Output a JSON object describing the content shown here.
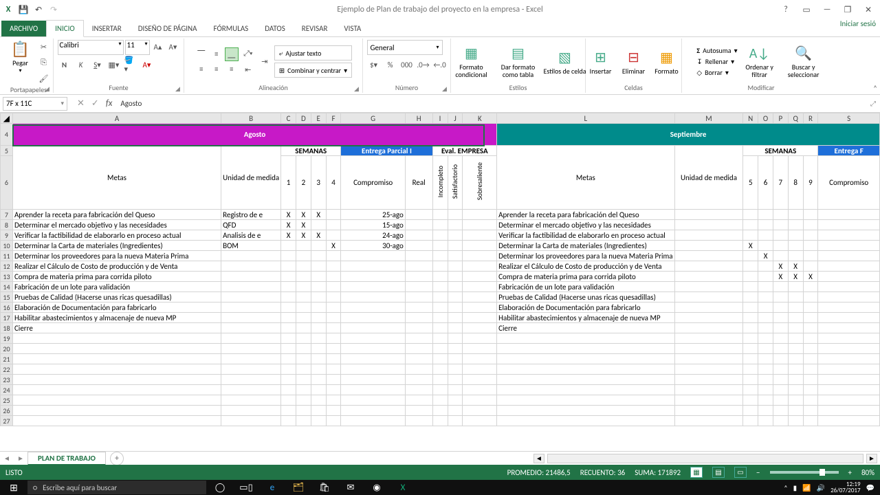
{
  "app": {
    "title": "Ejemplo de Plan de trabajo del proyecto en la empresa - Excel",
    "signin": "Iniciar sesió"
  },
  "tabs": {
    "file": "ARCHIVO",
    "inicio": "INICIO",
    "insertar": "INSERTAR",
    "diseno": "DISEÑO DE PÁGINA",
    "formulas": "FÓRMULAS",
    "datos": "DATOS",
    "revisar": "REVISAR",
    "vista": "VISTA"
  },
  "ribbon": {
    "paste": "Pegar",
    "portapapeles": "Portapapeles",
    "font_name": "Calibri",
    "font_size": "11",
    "fuente": "Fuente",
    "wrap": "Ajustar texto",
    "merge": "Combinar y centrar",
    "alineacion": "Alineación",
    "num_general": "General",
    "numero": "Número",
    "fcond": "Formato condicional",
    "ftabla": "Dar formato como tabla",
    "fcelda": "Estilos de celda",
    "estilos": "Estilos",
    "insertar": "Insertar",
    "eliminar": "Eliminar",
    "formato": "Formato",
    "celdas": "Celdas",
    "autosuma": "Autosuma",
    "rellenar": "Rellenar",
    "borrar": "Borrar",
    "ordenar": "Ordenar y filtrar",
    "buscar": "Buscar y seleccionar",
    "modificar": "Modificar"
  },
  "fxbar": {
    "name": "7F x 11C",
    "formula": "Agosto"
  },
  "cols": [
    "A",
    "B",
    "C",
    "D",
    "E",
    "F",
    "G",
    "H",
    "I",
    "J",
    "K",
    "L",
    "M",
    "N",
    "O",
    "P",
    "Q",
    "R",
    "S"
  ],
  "rows": [
    4,
    5,
    6,
    7,
    8,
    9,
    10,
    11,
    12,
    13,
    14,
    15,
    16,
    17,
    18,
    19,
    20,
    21,
    22,
    23,
    24,
    25,
    26,
    27
  ],
  "months": {
    "aug": "Agosto",
    "sep": "Septiembre"
  },
  "hdr": {
    "metas": "Metas",
    "unidad": "Unidad de medida",
    "semanas": "SEMANAS",
    "entrega": "Entrega Parcial I",
    "entrega2": "Entrega F",
    "evalemp": "Eval. EMPRESA",
    "compromiso": "Compromiso",
    "real": "Real",
    "incompleto": "Incompleto",
    "satisfactorio": "Satisfactorio",
    "sobresaliente": "Sobresaliente",
    "w1": "1",
    "w2": "2",
    "w3": "3",
    "w4": "4",
    "w5": "5",
    "w6": "6",
    "w7": "7",
    "w8": "8",
    "w9": "9"
  },
  "data": [
    {
      "meta": "Aprender la receta para fabricación del Queso",
      "unidad": "Registro de e",
      "w": [
        "X",
        "X",
        "X",
        ""
      ],
      "comp": "25-ago",
      "real": "",
      "s": [
        "",
        "",
        "",
        "",
        ""
      ]
    },
    {
      "meta": "Determinar el mercado objetivo y las necesidades",
      "unidad": "QFD",
      "w": [
        "X",
        "X",
        "",
        ""
      ],
      "comp": "15-ago",
      "real": "",
      "s": [
        "",
        "",
        "",
        "",
        ""
      ]
    },
    {
      "meta": "Verificar la factibilidad de elaborarlo en proceso actual",
      "unidad": "Analisis de e",
      "w": [
        "X",
        "X",
        "X",
        ""
      ],
      "comp": "24-ago",
      "real": "",
      "s": [
        "",
        "",
        "",
        "",
        ""
      ]
    },
    {
      "meta": "Determinar la Carta de materiales (Ingredientes)",
      "unidad": "BOM",
      "w": [
        "",
        "",
        "",
        "X"
      ],
      "comp": "30-ago",
      "real": "",
      "s": [
        "X",
        "",
        "",
        "",
        ""
      ]
    },
    {
      "meta": "Determinar los proveedores para la nueva Materia Prima",
      "unidad": "",
      "w": [
        "",
        "",
        "",
        ""
      ],
      "comp": "",
      "real": "",
      "s": [
        "",
        "X",
        "",
        "",
        ""
      ]
    },
    {
      "meta": "Realizar el Cálculo de Costo de producción y de Venta",
      "unidad": "",
      "w": [
        "",
        "",
        "",
        ""
      ],
      "comp": "",
      "real": "",
      "s": [
        "",
        "",
        "X",
        "X",
        ""
      ]
    },
    {
      "meta": "Compra de materia prima para corrida piloto",
      "unidad": "",
      "w": [
        "",
        "",
        "",
        ""
      ],
      "comp": "",
      "real": "",
      "s": [
        "",
        "",
        "X",
        "X",
        "X"
      ]
    },
    {
      "meta": "Fabricación de un lote para validación",
      "unidad": "",
      "w": [
        "",
        "",
        "",
        ""
      ],
      "comp": "",
      "real": "",
      "s": [
        "",
        "",
        "",
        "",
        ""
      ]
    },
    {
      "meta": "Pruebas de Calidad (Hacerse unas ricas quesadillas)",
      "unidad": "",
      "w": [
        "",
        "",
        "",
        ""
      ],
      "comp": "",
      "real": "",
      "s": [
        "",
        "",
        "",
        "",
        ""
      ]
    },
    {
      "meta": "Elaboración de Documentación para fabricarlo",
      "unidad": "",
      "w": [
        "",
        "",
        "",
        ""
      ],
      "comp": "",
      "real": "",
      "s": [
        "",
        "",
        "",
        "",
        ""
      ]
    },
    {
      "meta": "Habilitar abastecimientos y almacenaje de nueva MP",
      "unidad": "",
      "w": [
        "",
        "",
        "",
        ""
      ],
      "comp": "",
      "real": "",
      "s": [
        "",
        "",
        "",
        "",
        ""
      ]
    },
    {
      "meta": "Cierre",
      "unidad": "",
      "w": [
        "",
        "",
        "",
        ""
      ],
      "comp": "",
      "real": "",
      "s": [
        "",
        "",
        "",
        "",
        ""
      ]
    }
  ],
  "sheet": {
    "tab": "PLAN DE TRABAJO"
  },
  "status": {
    "ready": "LISTO",
    "avg": "PROMEDIO: 21486,5",
    "count": "RECUENTO: 36",
    "sum": "SUMA: 171892",
    "zoom": "80%"
  },
  "taskbar": {
    "search": "Escribe aquí para buscar",
    "time": "12:19",
    "date": "26/07/2017"
  }
}
